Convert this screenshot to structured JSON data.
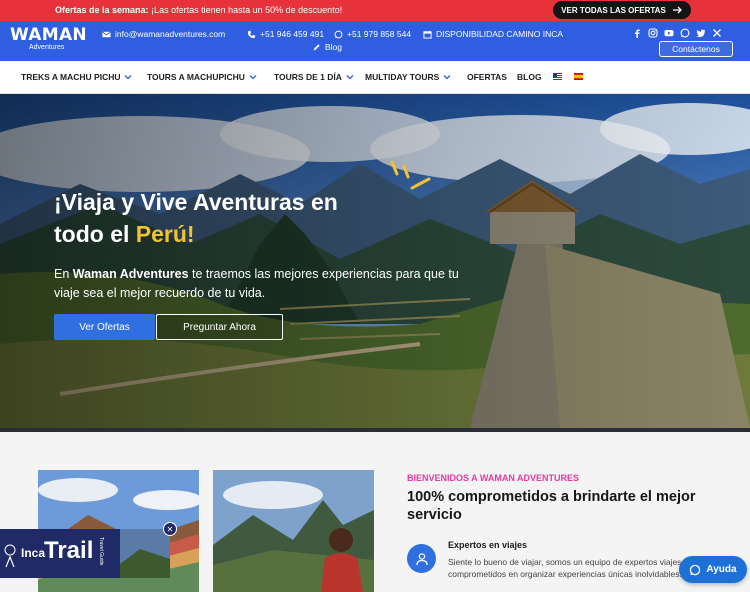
{
  "promo": {
    "label": "Ofertas de la semana:",
    "text": "¡Las ofertas tienen hasta un 50% de descuento!",
    "button": "VER TODAS LAS OFERTAS"
  },
  "header": {
    "logo_main": "WAMAN",
    "logo_sub": "Adventures",
    "email": "info@wamanadventures.com",
    "phone1": "+51 946 459 491",
    "phone2": "+51 979 858 544",
    "availability": "DISPONIBILIDAD CAMINO INCA",
    "blog": "Blog",
    "contact_button": "Contáctenos",
    "socials": [
      "facebook-icon",
      "instagram-icon",
      "youtube-icon",
      "whatsapp-icon",
      "twitter-icon",
      "x-icon"
    ]
  },
  "nav": {
    "items": [
      {
        "label": "TREKS A MACHU PICHU"
      },
      {
        "label": "TOURS A MACHUPICHU"
      },
      {
        "label": "TOURS DE 1 DÍA"
      },
      {
        "label": "MULTIDAY TOURS"
      },
      {
        "label": "OFERTAS"
      },
      {
        "label": "BLOG"
      }
    ]
  },
  "hero": {
    "title_line1": "¡Viaja y Vive Aventuras en",
    "title_line2_a": "todo el ",
    "title_line2_b": "Perú!",
    "text_a": "En ",
    "text_brand": "Waman Adventures",
    "text_b": " te traemos las mejores experiencias para que tu viaje sea el mejor recuerdo de tu vida.",
    "btn_primary": "Ver Ofertas",
    "btn_secondary": "Preguntar Ahora"
  },
  "about": {
    "eyebrow": "BIENVENIDOS A WAMAN ADVENTURES",
    "headline": "100% comprometidos a brindarte el mejor servicio",
    "feature_title": "Expertos en viajes",
    "feature_text": "Siente lo bueno de viajar, somos un equipo de expertos viajes comprometidos en organizar experiencias únicas inolvidables."
  },
  "inca_ad": {
    "word1": "Inca",
    "word2": "Trail",
    "sub": "Travel Guide"
  },
  "help_button": "Ayuda",
  "colors": {
    "promo_red": "#e8323b",
    "header_blue": "#2f5fe0",
    "accent_yellow": "#f2c233",
    "eyebrow_pink": "#e23aa4"
  }
}
